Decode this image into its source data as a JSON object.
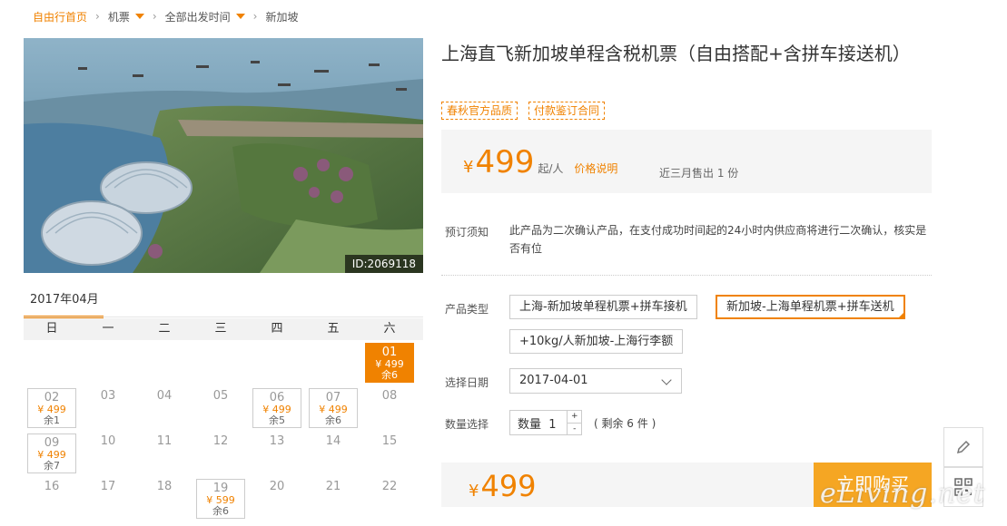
{
  "breadcrumb": {
    "home": "自由行首页",
    "items": [
      "机票",
      "全部出发时间",
      "新加坡"
    ]
  },
  "hero": {
    "image_id": "ID:2069118"
  },
  "product": {
    "title": "上海直飞新加坡单程含税机票（自由搭配+含拼车接送机）",
    "tags": [
      "春秋官方品质",
      "付款鉴订合同"
    ]
  },
  "price": {
    "currency": "¥",
    "amount": "499",
    "unit": "起/人",
    "note_link": "价格说明",
    "sold": "近三月售出 1 份"
  },
  "notice": {
    "label": "预订须知",
    "text": "此产品为二次确认产品，在支付成功时间起的24小时内供应商将进行二次确认，核实是否有位"
  },
  "product_type": {
    "label": "产品类型",
    "options": [
      "上海-新加坡单程机票+拼车接机",
      "新加坡-上海单程机票+拼车送机",
      "+10kg/人新加坡-上海行李额"
    ],
    "selected_index": 1
  },
  "date": {
    "label": "选择日期",
    "value": "2017-04-01"
  },
  "quantity": {
    "label": "数量选择",
    "prefix": "数量",
    "value": "1",
    "plus": "+",
    "minus": "-",
    "remaining": "( 剩余 6 件 )"
  },
  "bottom": {
    "currency": "¥",
    "amount": "499",
    "buy_label": "立即购买"
  },
  "calendar": {
    "month": "2017年04月",
    "weekdays": [
      "日",
      "一",
      "二",
      "三",
      "四",
      "五",
      "六"
    ],
    "leading_blanks": 6,
    "days": [
      {
        "d": "01",
        "price": "¥ 499",
        "rem": "余6",
        "active": true
      },
      {
        "d": "02",
        "price": "¥ 499",
        "rem": "余1"
      },
      {
        "d": "03"
      },
      {
        "d": "04"
      },
      {
        "d": "05"
      },
      {
        "d": "06",
        "price": "¥ 499",
        "rem": "余5"
      },
      {
        "d": "07",
        "price": "¥ 499",
        "rem": "余6"
      },
      {
        "d": "08"
      },
      {
        "d": "09",
        "price": "¥ 499",
        "rem": "余7"
      },
      {
        "d": "10"
      },
      {
        "d": "11"
      },
      {
        "d": "12"
      },
      {
        "d": "13"
      },
      {
        "d": "14"
      },
      {
        "d": "15"
      },
      {
        "d": "16"
      },
      {
        "d": "17"
      },
      {
        "d": "18"
      },
      {
        "d": "19",
        "price": "¥ 599",
        "rem": "余6"
      },
      {
        "d": "20"
      },
      {
        "d": "21"
      },
      {
        "d": "22"
      }
    ]
  },
  "watermark": "eLiving.net",
  "colors": {
    "accent": "#f08200",
    "buy_button": "#f5a623",
    "panel_bg": "#f5f5f5"
  },
  "icons": [
    "pencil-icon",
    "qr-code-icon",
    "chevron-down-icon",
    "caret-down-icon"
  ]
}
